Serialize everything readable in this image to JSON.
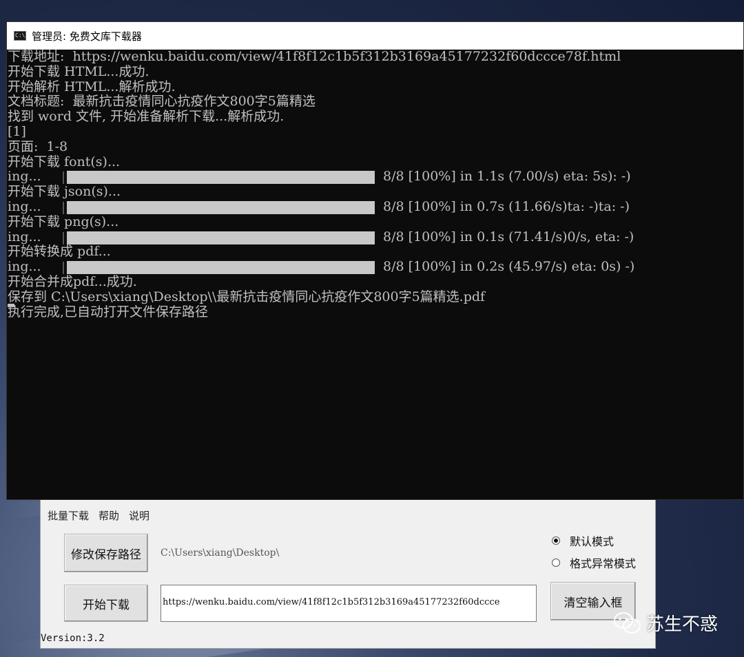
{
  "console": {
    "title": "管理员: 免费文库下载器",
    "icon": "cmd-icon",
    "lines": [
      {
        "text": "下载地址:  https://wenku.baidu.com/view/41f8f12c1b5f312b3169a45177232f60dccce78f.html"
      },
      {
        "text": "开始下载 HTML...成功."
      },
      {
        "text": "开始解析 HTML...解析成功."
      },
      {
        "text": "文档标题:  最新抗击疫情同心抗疫作文800字5篇精选"
      },
      {
        "text": "找到 word 文件, 开始准备解析下载...解析成功."
      },
      {
        "text": "[1]"
      },
      {
        "text": "页面:  1-8"
      },
      {
        "text": "开始下载 font(s)..."
      },
      {
        "progress": {
          "prefix": "ing...",
          "fraction": 1.0,
          "stats": "8/8 [100%] in 1.1s (7.00/s) eta: 5s): -)"
        }
      },
      {
        "text": "开始下载 json(s)..."
      },
      {
        "progress": {
          "prefix": "ing...",
          "fraction": 1.0,
          "stats": "8/8 [100%] in 0.7s (11.66/s)ta: -)ta: -)"
        }
      },
      {
        "text": "开始下载 png(s)..."
      },
      {
        "progress": {
          "prefix": "ing...",
          "fraction": 1.0,
          "stats": "8/8 [100%] in 0.1s (71.41/s)0/s, eta: -)"
        }
      },
      {
        "text": "开始转换成 pdf..."
      },
      {
        "progress": {
          "prefix": "ing...",
          "fraction": 1.0,
          "stats": "8/8 [100%] in 0.2s (45.97/s) eta: 0s) -)"
        }
      },
      {
        "text": "开始合并成pdf...成功."
      },
      {
        "text": "保存到 C:\\Users\\xiang\\Desktop\\\\最新抗击疫情同心抗疫作文800字5篇精选.pdf"
      },
      {
        "text": "执行完成,已自动打开文件保存路径"
      }
    ],
    "colors": {
      "background": "#0c0c0c",
      "text": "#c0c0c0",
      "progress": "#c8c8c8"
    }
  },
  "gui": {
    "menu": [
      "批量下载",
      "帮助",
      "说明"
    ],
    "change_path_button": "修改保存路径",
    "save_path": "C:\\Users\\xiang\\Desktop\\",
    "start_button": "开始下载",
    "url_value": "https://wenku.baidu.com/view/41f8f12c1b5f312b3169a45177232f60dccce",
    "clear_button": "清空输入框",
    "modes": [
      {
        "label": "默认模式",
        "checked": true
      },
      {
        "label": "格式异常模式",
        "checked": false
      }
    ],
    "version": "Version:3.2"
  },
  "watermark": {
    "text": "苏生不惑",
    "icon": "wechat-icon"
  }
}
